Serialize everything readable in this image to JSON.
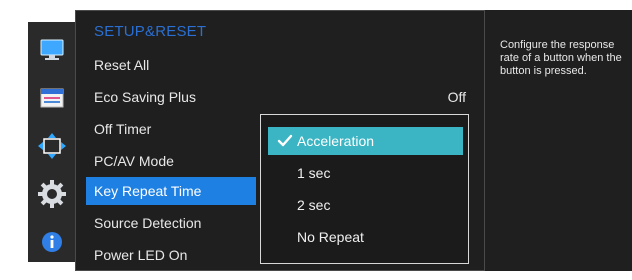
{
  "icons": [
    {
      "name": "picture-icon",
      "selected": false
    },
    {
      "name": "onscreen-display-icon",
      "selected": false
    },
    {
      "name": "position-size-icon",
      "selected": false
    },
    {
      "name": "setup-reset-gear-icon",
      "selected": true
    },
    {
      "name": "information-icon",
      "selected": false
    }
  ],
  "menu": {
    "title": "SETUP&RESET",
    "items": [
      {
        "label": "Reset All"
      },
      {
        "label": "Eco Saving Plus",
        "value": "Off"
      },
      {
        "label": "Off Timer"
      },
      {
        "label": "PC/AV Mode"
      },
      {
        "label": "Key Repeat Time",
        "selected": true
      },
      {
        "label": "Source Detection"
      },
      {
        "label": "Power LED On"
      }
    ]
  },
  "submenu": {
    "options": [
      {
        "label": "Acceleration",
        "checked": true
      },
      {
        "label": "1 sec"
      },
      {
        "label": "2 sec"
      },
      {
        "label": "No Repeat"
      }
    ]
  },
  "description": {
    "text": "Configure the response rate of a button when the button is pressed."
  },
  "colors": {
    "title": "#2a6fd1",
    "menu_highlight": "#1f80e3",
    "submenu_highlight": "#3bb5c3",
    "panel": "#1f1f1f"
  }
}
